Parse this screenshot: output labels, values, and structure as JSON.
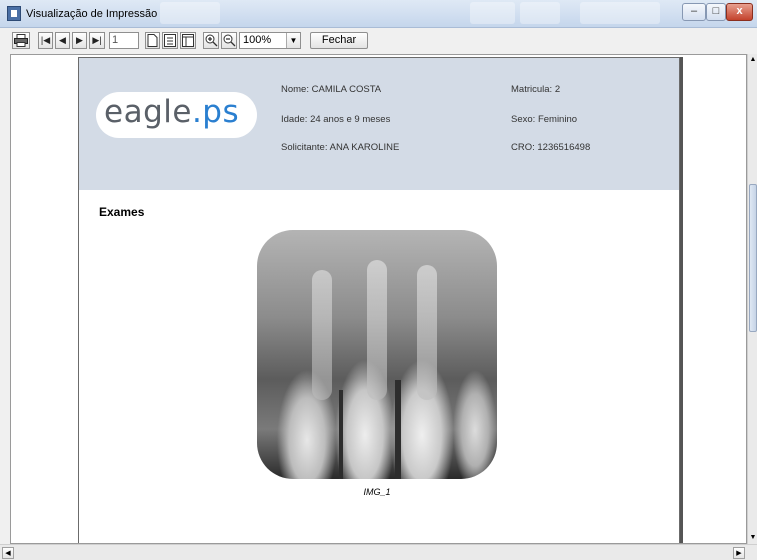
{
  "window": {
    "title": "Visualização de Impressão",
    "icon": "print-preview-icon",
    "controls": {
      "minimize": "–",
      "maximize": "□",
      "close": "x"
    }
  },
  "toolbar": {
    "print_icon": "printer-icon",
    "first_page": "|◀",
    "prev_page": "◀",
    "next_page": "▶",
    "last_page": "▶|",
    "page_number": "1",
    "zoom_value": "100%",
    "close_label": "Fechar"
  },
  "report": {
    "logo": {
      "prefix": "eagle",
      "dot": ".",
      "suffix": "ps"
    },
    "patient": {
      "name_label": "Nome:",
      "name": "CAMILA COSTA",
      "age_label": "Idade:",
      "age": "24 anos e 9 meses",
      "requester_label": "Solicitante:",
      "requester": "ANA KAROLINE",
      "registration_label": "Matricula:",
      "registration": "2",
      "sex_label": "Sexo:",
      "sex": "Feminino",
      "cro_label": "CRO:",
      "cro": "1236516498"
    },
    "section_title": "Exames",
    "images": [
      {
        "caption": "IMG_1"
      }
    ]
  },
  "colors": {
    "header_bg": "#d3dbe6",
    "logo_accent": "#2a7fd0",
    "logo_gray": "#5a6068"
  }
}
